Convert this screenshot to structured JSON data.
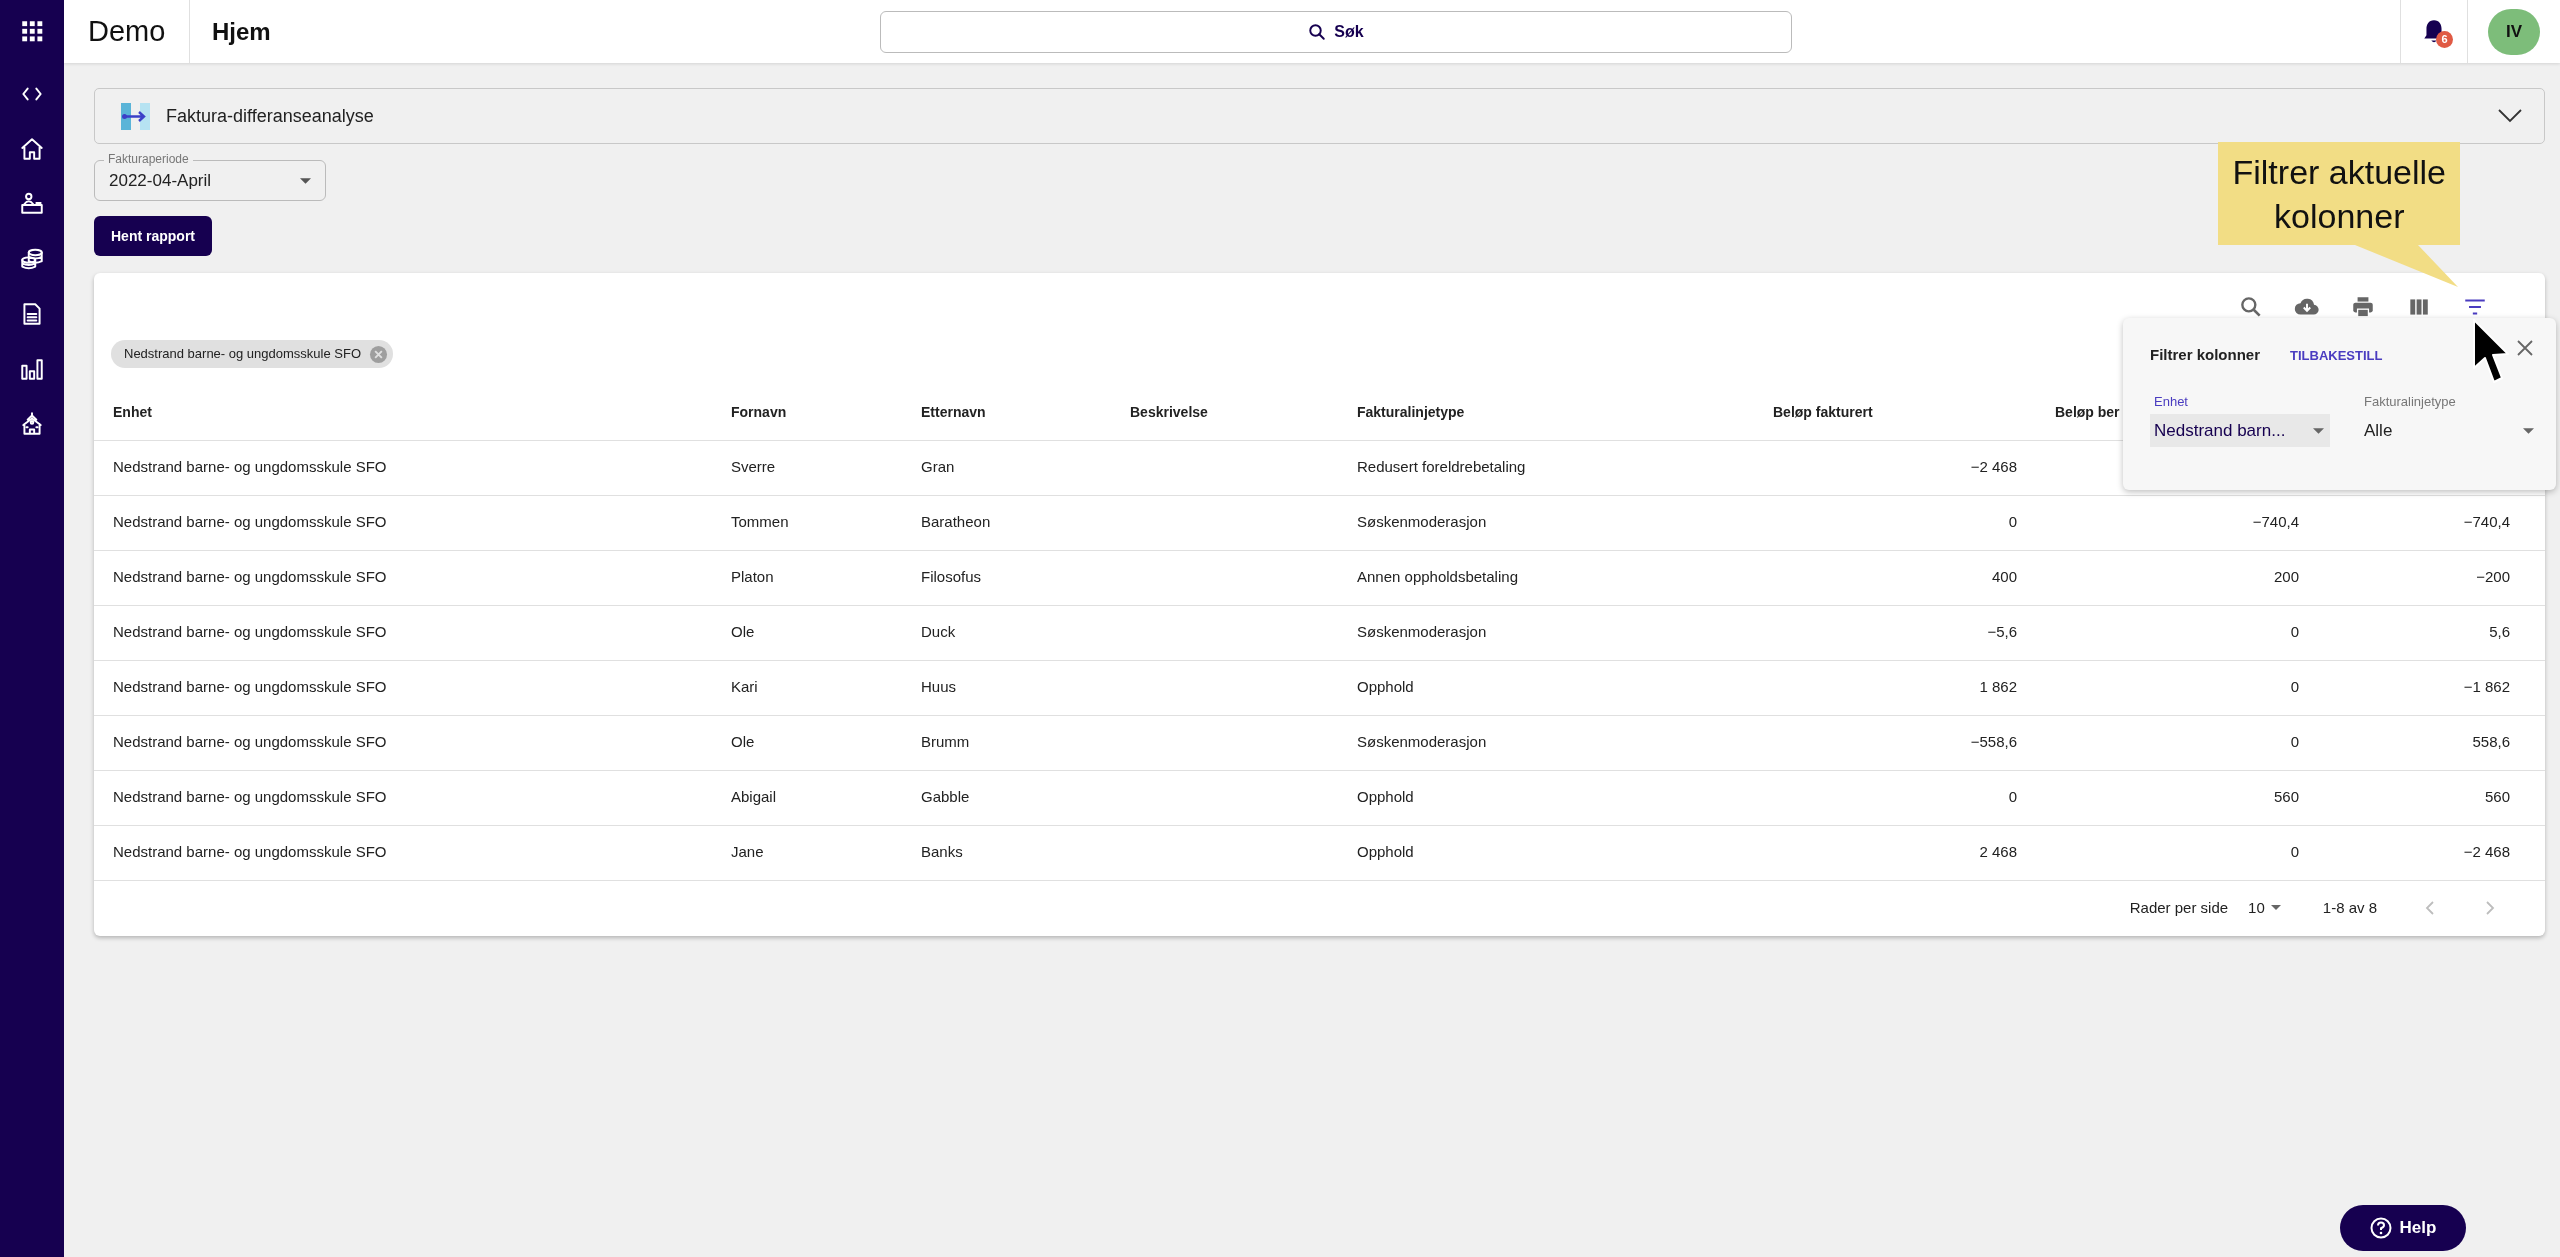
{
  "header": {
    "app_name": "Demo",
    "page": "Hjem",
    "search": {
      "label": "Søk"
    },
    "notifications": {
      "count": "6"
    },
    "avatar": {
      "initials": "IV"
    }
  },
  "report": {
    "title": "Faktura-differanseanalyse"
  },
  "period_select": {
    "label": "Fakturaperiode",
    "value": "2022-04-April"
  },
  "fetch_button": {
    "label": "Hent rapport"
  },
  "table": {
    "toolbar": [
      {
        "kind": "search",
        "selected": false
      },
      {
        "kind": "download",
        "selected": false
      },
      {
        "kind": "print",
        "selected": false
      },
      {
        "kind": "columns",
        "selected": false
      },
      {
        "kind": "filter",
        "selected": true
      }
    ],
    "chips": [
      {
        "label": "Nedstrand barne- og ungdomsskule SFO"
      }
    ],
    "columns": [
      "Enhet",
      "Fornavn",
      "Etternavn",
      "Beskrivelse",
      "Fakturalinjetype",
      "Beløp fakturert",
      "Beløp ber"
    ],
    "rows": [
      [
        "Nedstrand barne- og ungdomsskule SFO",
        "Sverre",
        "Gran",
        null,
        "Redusert foreldrebetaling",
        "−2 468"
      ],
      [
        "Nedstrand barne- og ungdomsskule SFO",
        "Tommen",
        "Baratheon",
        null,
        "Søskenmoderasjon",
        "0",
        "−740,4",
        "−740,4"
      ],
      [
        "Nedstrand barne- og ungdomsskule SFO",
        "Platon",
        "Filosofus",
        null,
        "Annen oppholdsbetaling",
        "400",
        "200",
        "−200"
      ],
      [
        "Nedstrand barne- og ungdomsskule SFO",
        "Ole",
        "Duck",
        null,
        "Søskenmoderasjon",
        "−5,6",
        "0",
        "5,6"
      ],
      [
        "Nedstrand barne- og ungdomsskule SFO",
        "Kari",
        "Huus",
        null,
        "Opphold",
        "1 862",
        "0",
        "−1 862"
      ],
      [
        "Nedstrand barne- og ungdomsskule SFO",
        "Ole",
        "Brumm",
        null,
        "Søskenmoderasjon",
        "−558,6",
        "0",
        "558,6"
      ],
      [
        "Nedstrand barne- og ungdomsskule SFO",
        "Abigail",
        "Gabble",
        null,
        "Opphold",
        "0",
        "560",
        "560"
      ],
      [
        "Nedstrand barne- og ungdomsskule SFO",
        "Jane",
        "Banks",
        null,
        "Opphold",
        "2 468",
        "0",
        "−2 468"
      ]
    ],
    "pagination": {
      "rows_per_page_label": "Rader per side",
      "rows_per_page": "10",
      "range": "1-8 av 8",
      "prev_disabled": true,
      "next_disabled": true
    }
  },
  "filter_panel": {
    "title": "Filtrer kolonner",
    "reset": "TILBAKESTILL",
    "fields": [
      {
        "label": "Enhet",
        "value": "Nedstrand barn...",
        "focused": true
      },
      {
        "label": "Fakturalinjetype",
        "value": "Alle",
        "focused": false
      }
    ]
  },
  "callout": {
    "lines": [
      "Filtrer aktuelle",
      "kolonner"
    ]
  },
  "help_button": {
    "label": "Help"
  }
}
